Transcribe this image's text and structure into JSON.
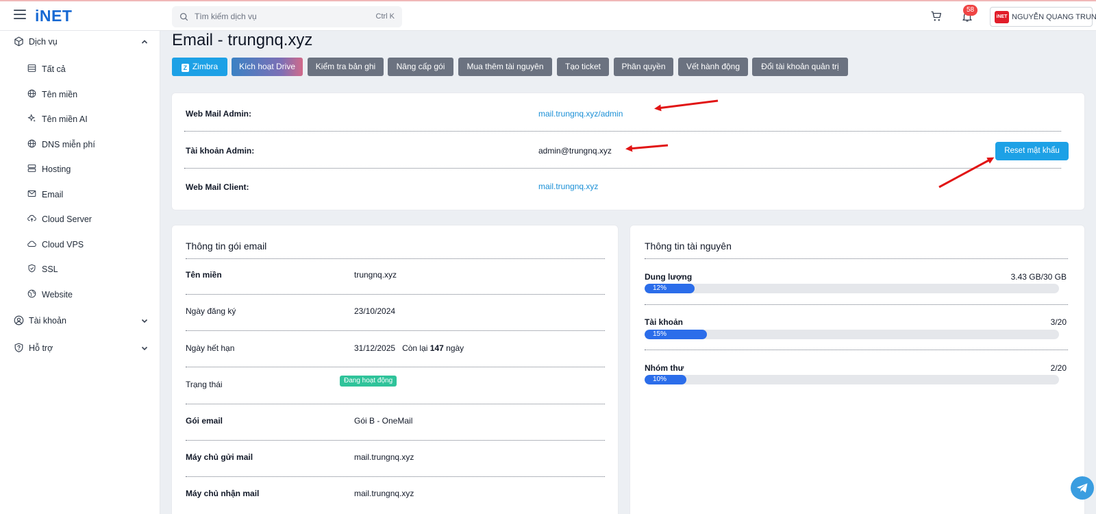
{
  "app": {
    "logo": "iNET",
    "accent": "#1da1e6",
    "brand": "#1769d3"
  },
  "header": {
    "search_placeholder": "Tìm kiếm dịch vụ",
    "search_shortcut": "Ctrl K",
    "notification_count": "58",
    "user_logo": "iNET",
    "user_name": "NGUYỄN QUANG TRUNG"
  },
  "sidebar": {
    "groups": [
      {
        "label": "Dịch vụ",
        "icon": "cube-icon",
        "expanded": true
      },
      {
        "label": "Tài khoản",
        "icon": "user-circle-icon",
        "expanded": false
      },
      {
        "label": "Hỗ trợ",
        "icon": "shield-question-icon",
        "expanded": false
      }
    ],
    "items": [
      {
        "label": "Tất cả",
        "icon": "list-icon"
      },
      {
        "label": "Tên miền",
        "icon": "globe-icon"
      },
      {
        "label": "Tên miền AI",
        "icon": "sparkle-icon"
      },
      {
        "label": "DNS miễn phí",
        "icon": "globe-icon"
      },
      {
        "label": "Hosting",
        "icon": "server-icon"
      },
      {
        "label": "Email",
        "icon": "mail-icon"
      },
      {
        "label": "Cloud Server",
        "icon": "cloud-upload-icon"
      },
      {
        "label": "Cloud VPS",
        "icon": "cloud-icon"
      },
      {
        "label": "SSL",
        "icon": "shield-check-icon"
      },
      {
        "label": "Website",
        "icon": "globe-network-icon"
      }
    ]
  },
  "page": {
    "title": "Email - trungnq.xyz",
    "actions": [
      "Zimbra",
      "Kích hoạt Drive",
      "Kiểm tra bản ghi",
      "Nâng cấp gói",
      "Mua thêm tài nguyên",
      "Tạo ticket",
      "Phân quyền",
      "Vết hành động",
      "Đổi tài khoản quản trị"
    ]
  },
  "admin_card": {
    "rows": [
      {
        "label": "Web Mail Admin:",
        "value": "mail.trungnq.xyz/admin"
      },
      {
        "label": "Tài khoản Admin:",
        "value": "admin@trungnq.xyz"
      },
      {
        "label": "Web Mail Client:",
        "value": "mail.trungnq.xyz"
      }
    ],
    "reset_label": "Reset mật khẩu"
  },
  "package": {
    "title": "Thông tin gói email",
    "rows": [
      {
        "label": "Tên miền",
        "value": "trungnq.xyz"
      },
      {
        "label": "Ngày đăng ký",
        "value": "23/10/2024"
      },
      {
        "label": "Ngày hết hạn",
        "value": "31/12/2025",
        "remain_prefix": "Còn lại",
        "remain_days": "147",
        "remain_suffix": "ngày"
      },
      {
        "label": "Trạng thái",
        "value": "Đang hoạt động",
        "status_color": "#2fc39a"
      },
      {
        "label": "Gói email",
        "value": "Gói B - OneMail"
      },
      {
        "label": "Máy chủ gửi mail",
        "value": "mail.trungnq.xyz"
      },
      {
        "label": "Máy chủ nhận mail",
        "value": "mail.trungnq.xyz"
      }
    ]
  },
  "resources": {
    "title": "Thông tin tài nguyên",
    "items": [
      {
        "label": "Dung lượng",
        "value": "3.43 GB/30 GB",
        "percent_label": "12%",
        "percent": 12
      },
      {
        "label": "Tài khoản",
        "value": "3/20",
        "percent_label": "15%",
        "percent": 15
      },
      {
        "label": "Nhóm thư",
        "value": "2/20",
        "percent_label": "10%",
        "percent": 10
      }
    ]
  }
}
